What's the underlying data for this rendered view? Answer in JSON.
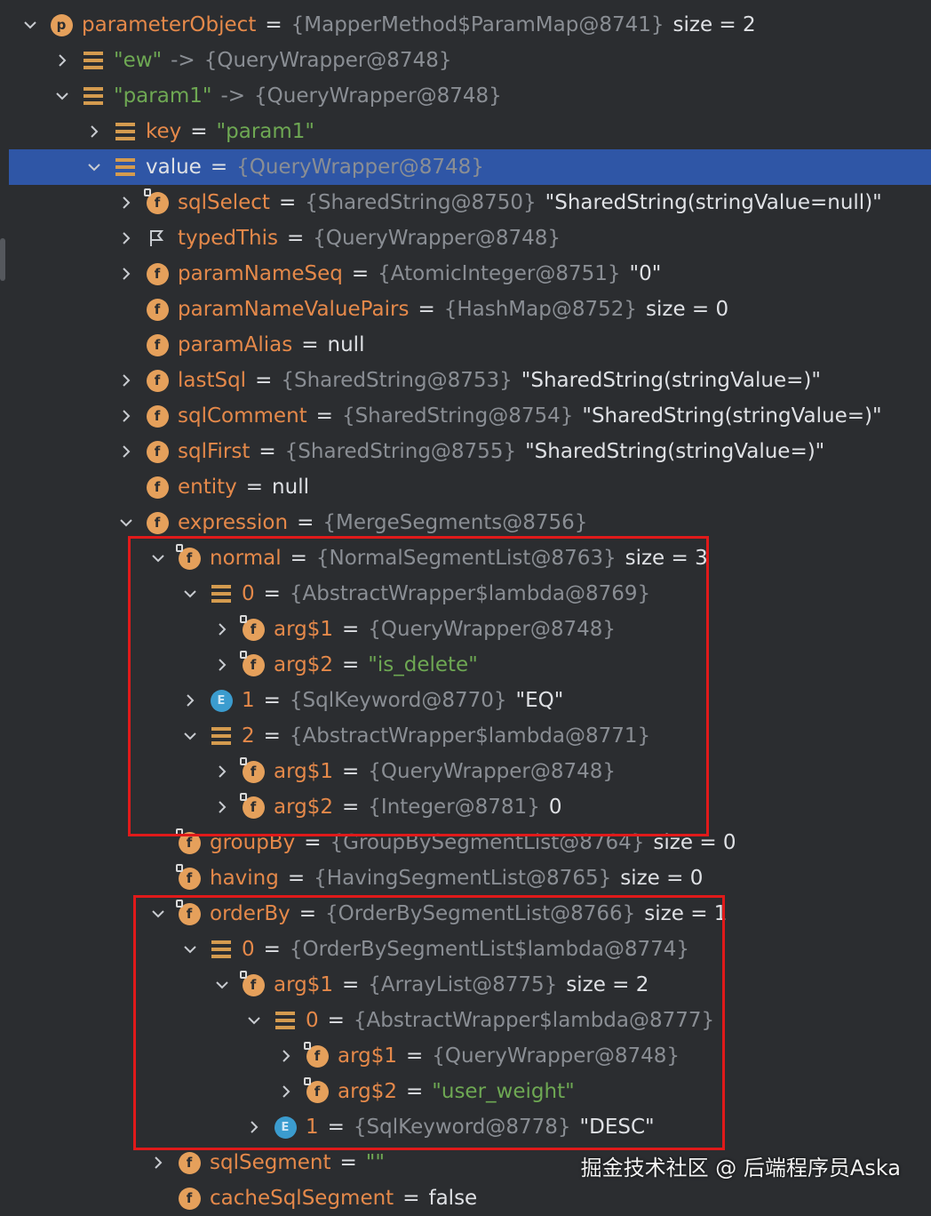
{
  "rows": [
    {
      "depth": 0,
      "arrow": "down",
      "icon": "p",
      "name": "parameterObject",
      "sep": "=",
      "type": "{MapperMethod$ParamMap@8741}",
      "extra": "size = 2"
    },
    {
      "depth": 1,
      "arrow": "right",
      "icon": "lines",
      "name": "\"ew\"",
      "nameStyle": "str",
      "sep": "->",
      "type": "{QueryWrapper@8748}"
    },
    {
      "depth": 1,
      "arrow": "down",
      "icon": "lines",
      "name": "\"param1\"",
      "nameStyle": "str",
      "sep": "->",
      "type": "{QueryWrapper@8748}"
    },
    {
      "depth": 2,
      "arrow": "right",
      "icon": "lines",
      "name": "key",
      "sep": "=",
      "strval": "\"param1\""
    },
    {
      "depth": 2,
      "arrow": "down",
      "icon": "lines",
      "name": "value",
      "nameStyle": "white",
      "sep": "=",
      "type": "{QueryWrapper@8748}",
      "selected": true
    },
    {
      "depth": 3,
      "arrow": "right",
      "icon": "flock",
      "name": "sqlSelect",
      "sep": "=",
      "type": "{SharedString@8750}",
      "extra": "\"SharedString(stringValue=null)\""
    },
    {
      "depth": 3,
      "arrow": "right",
      "icon": "flag",
      "name": "typedThis",
      "sep": "=",
      "type": "{QueryWrapper@8748}"
    },
    {
      "depth": 3,
      "arrow": "right",
      "icon": "f",
      "name": "paramNameSeq",
      "sep": "=",
      "type": "{AtomicInteger@8751}",
      "extra": "\"0\""
    },
    {
      "depth": 3,
      "arrow": "none",
      "icon": "f",
      "name": "paramNameValuePairs",
      "sep": "=",
      "type": "{HashMap@8752}",
      "extra": "size = 0"
    },
    {
      "depth": 3,
      "arrow": "none",
      "icon": "f",
      "name": "paramAlias",
      "sep": "=",
      "plainval": "null"
    },
    {
      "depth": 3,
      "arrow": "right",
      "icon": "f",
      "name": "lastSql",
      "sep": "=",
      "type": "{SharedString@8753}",
      "extra": "\"SharedString(stringValue=)\""
    },
    {
      "depth": 3,
      "arrow": "right",
      "icon": "f",
      "name": "sqlComment",
      "sep": "=",
      "type": "{SharedString@8754}",
      "extra": "\"SharedString(stringValue=)\""
    },
    {
      "depth": 3,
      "arrow": "right",
      "icon": "f",
      "name": "sqlFirst",
      "sep": "=",
      "type": "{SharedString@8755}",
      "extra": "\"SharedString(stringValue=)\""
    },
    {
      "depth": 3,
      "arrow": "none",
      "icon": "f",
      "name": "entity",
      "sep": "=",
      "plainval": "null"
    },
    {
      "depth": 3,
      "arrow": "down",
      "icon": "f",
      "name": "expression",
      "sep": "=",
      "type": "{MergeSegments@8756}"
    },
    {
      "depth": 4,
      "arrow": "down",
      "icon": "flock",
      "name": "normal",
      "sep": "=",
      "type": "{NormalSegmentList@8763}",
      "extra": "size = 3"
    },
    {
      "depth": 5,
      "arrow": "down",
      "icon": "lines",
      "name": "0",
      "sep": "=",
      "type": "{AbstractWrapper$lambda@8769}"
    },
    {
      "depth": 6,
      "arrow": "right",
      "icon": "flock",
      "name": "arg$1",
      "sep": "=",
      "type": "{QueryWrapper@8748}"
    },
    {
      "depth": 6,
      "arrow": "right",
      "icon": "flock",
      "name": "arg$2",
      "sep": "=",
      "strval": "\"is_delete\""
    },
    {
      "depth": 5,
      "arrow": "right",
      "icon": "e",
      "name": "1",
      "sep": "=",
      "type": "{SqlKeyword@8770}",
      "extra": "\"EQ\""
    },
    {
      "depth": 5,
      "arrow": "down",
      "icon": "lines",
      "name": "2",
      "sep": "=",
      "type": "{AbstractWrapper$lambda@8771}"
    },
    {
      "depth": 6,
      "arrow": "right",
      "icon": "flock",
      "name": "arg$1",
      "sep": "=",
      "type": "{QueryWrapper@8748}"
    },
    {
      "depth": 6,
      "arrow": "right",
      "icon": "flock",
      "name": "arg$2",
      "sep": "=",
      "type": "{Integer@8781}",
      "extra": "0"
    },
    {
      "depth": 4,
      "arrow": "none",
      "icon": "flock",
      "name": "groupBy",
      "sep": "=",
      "type": "{GroupBySegmentList@8764}",
      "extra": "size = 0"
    },
    {
      "depth": 4,
      "arrow": "none",
      "icon": "flock",
      "name": "having",
      "sep": "=",
      "type": "{HavingSegmentList@8765}",
      "extra": "size = 0"
    },
    {
      "depth": 4,
      "arrow": "down",
      "icon": "flock",
      "name": "orderBy",
      "sep": "=",
      "type": "{OrderBySegmentList@8766}",
      "extra": "size = 1"
    },
    {
      "depth": 5,
      "arrow": "down",
      "icon": "lines",
      "name": "0",
      "sep": "=",
      "type": "{OrderBySegmentList$lambda@8774}"
    },
    {
      "depth": 6,
      "arrow": "down",
      "icon": "flock",
      "name": "arg$1",
      "sep": "=",
      "type": "{ArrayList@8775}",
      "extra": "size = 2"
    },
    {
      "depth": 7,
      "arrow": "down",
      "icon": "lines",
      "name": "0",
      "sep": "=",
      "type": "{AbstractWrapper$lambda@8777}"
    },
    {
      "depth": 8,
      "arrow": "right",
      "icon": "flock",
      "name": "arg$1",
      "sep": "=",
      "type": "{QueryWrapper@8748}"
    },
    {
      "depth": 8,
      "arrow": "right",
      "icon": "flock",
      "name": "arg$2",
      "sep": "=",
      "strval": "\"user_weight\""
    },
    {
      "depth": 7,
      "arrow": "right",
      "icon": "e",
      "name": "1",
      "sep": "=",
      "type": "{SqlKeyword@8778}",
      "extra": "\"DESC\""
    },
    {
      "depth": 4,
      "arrow": "right",
      "icon": "f",
      "name": "sqlSegment",
      "sep": "=",
      "strval": "\"\""
    },
    {
      "depth": 4,
      "arrow": "none",
      "icon": "f",
      "name": "cacheSqlSegment",
      "sep": "=",
      "plainval": "false"
    }
  ],
  "watermark": "掘金技术社区 @ 后端程序员Aska",
  "colors": {
    "highlight": "#e01a1a",
    "selection": "#2f56a6"
  }
}
